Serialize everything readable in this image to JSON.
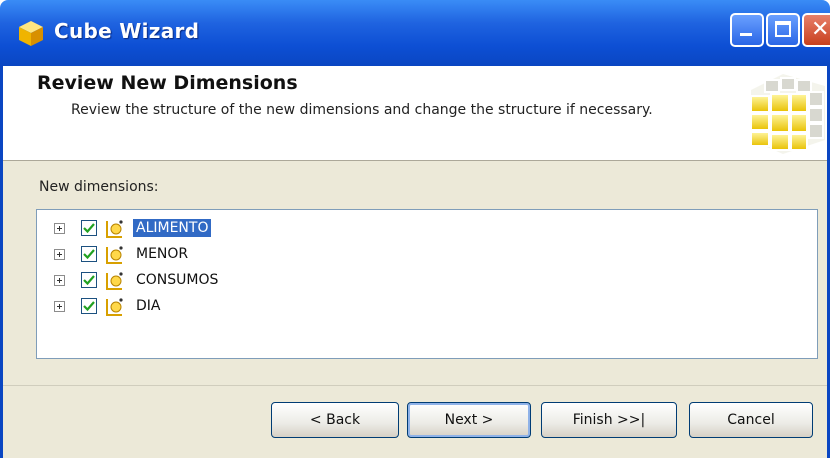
{
  "window": {
    "title": "Cube Wizard"
  },
  "header": {
    "title": "Review New Dimensions",
    "description": "Review the structure of the new dimensions and change the structure if necessary."
  },
  "dimensions_label": "New dimensions:",
  "dimensions": [
    {
      "label": "ALIMENTO",
      "checked": true,
      "selected": true
    },
    {
      "label": "MENOR",
      "checked": true,
      "selected": false
    },
    {
      "label": "CONSUMOS",
      "checked": true,
      "selected": false
    },
    {
      "label": "DIA",
      "checked": true,
      "selected": false
    }
  ],
  "buttons": {
    "back": "< Back",
    "next": "Next >",
    "finish": "Finish >>|",
    "cancel": "Cancel"
  },
  "colors": {
    "titlebar": "#0a46c2",
    "selection": "#316ac5",
    "window_bg": "#ece9d8"
  },
  "icons": {
    "title": "cube-wizard-icon",
    "dimension": "dimension-icon",
    "wizard_art": "cube-graphic"
  }
}
